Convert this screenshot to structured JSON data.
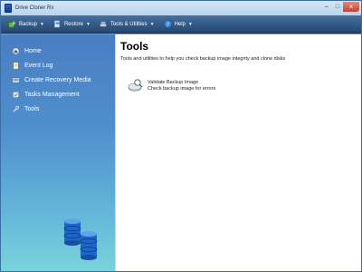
{
  "window": {
    "title": "Drive Cloner Rx"
  },
  "menubar": {
    "items": [
      {
        "label": "Backup",
        "icon": "backup-icon"
      },
      {
        "label": "Restore",
        "icon": "restore-icon"
      },
      {
        "label": "Tools & Utilities",
        "icon": "tools-icon"
      },
      {
        "label": "Help",
        "icon": "help-icon"
      }
    ]
  },
  "sidebar": {
    "items": [
      {
        "label": "Home",
        "icon": "home-icon"
      },
      {
        "label": "Event Log",
        "icon": "event-log-icon"
      },
      {
        "label": "Create Recovery Media",
        "icon": "recovery-media-icon"
      },
      {
        "label": "Tasks Management",
        "icon": "tasks-icon"
      },
      {
        "label": "Tools",
        "icon": "tools-icon"
      }
    ]
  },
  "main": {
    "title": "Tools",
    "description": "Tools and utilities to help you check backup image integrity and clone disks",
    "tools": [
      {
        "title": "Validate Backup Image",
        "subtitle": "Check backup image for errors",
        "icon": "validate-image-icon"
      }
    ]
  },
  "colors": {
    "menubar": "#2f5682",
    "sidebar_top": "#4a7ec2",
    "sidebar_bottom": "#79d3db",
    "database": "#1d66c9"
  }
}
